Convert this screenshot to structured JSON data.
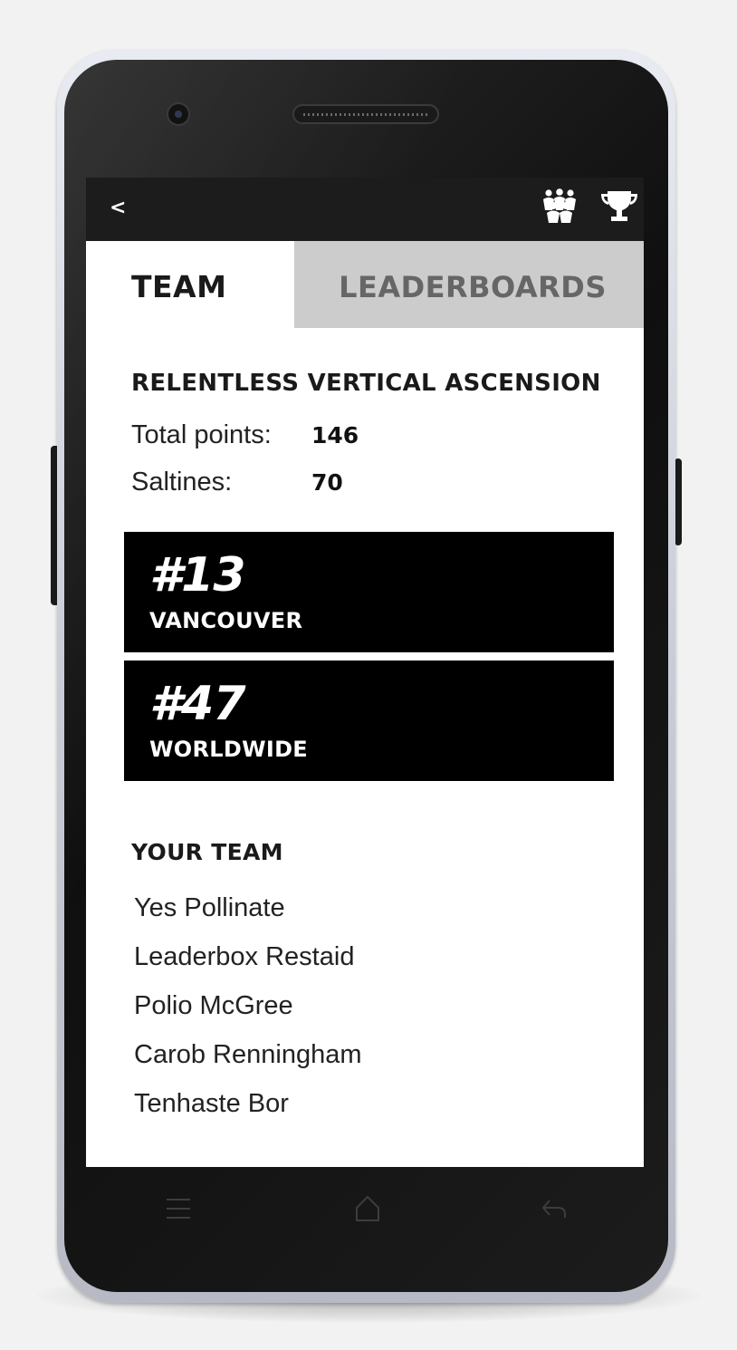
{
  "header": {
    "back_label": "<",
    "icons": [
      "team-icon",
      "trophy-icon"
    ]
  },
  "tabs": [
    {
      "label": "TEAM",
      "active": true
    },
    {
      "label": "LEADERBOARDS",
      "active": false
    }
  ],
  "team": {
    "name": "RELENTLESS VERTICAL ASCENSION",
    "stats": [
      {
        "label": "Total points:",
        "value": "146"
      },
      {
        "label": "Saltines:",
        "value": "70"
      }
    ],
    "ranks": [
      {
        "rank": "#13",
        "place": "VANCOUVER"
      },
      {
        "rank": "#47",
        "place": "WORLDWIDE"
      }
    ]
  },
  "your_team": {
    "title": "YOUR TEAM",
    "members": [
      "Yes Pollinate",
      "Leaderbox Restaid",
      "Polio McGree",
      "Carob Renningham",
      "Tenhaste Bor"
    ]
  },
  "nav_keys": [
    "menu-icon",
    "home-icon",
    "back-arrow-icon"
  ],
  "colors": {
    "topbar": "#1c1c1c",
    "inactive_tab": "#cccccc",
    "rank_card": "#000000"
  }
}
